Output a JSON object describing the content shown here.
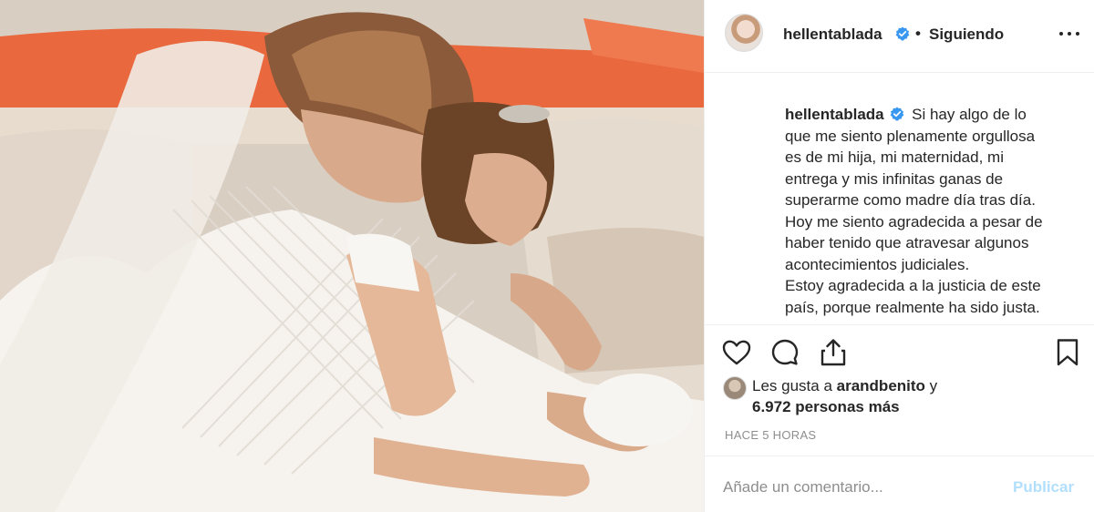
{
  "post": {
    "photo_description_icon": "wedding-photo",
    "header": {
      "username": "hellentablada",
      "verified_icon": "verified-badge-icon",
      "separator": "•",
      "follow_status": "Siguiendo",
      "more_icon": "more-options-icon"
    },
    "caption": {
      "username": "hellentablada",
      "lines": [
        "Si hay algo de lo",
        "que me siento plenamente orgullosa",
        "es de mi hija, mi maternidad, mi",
        "entrega y mis infinitas ganas de",
        "superarme como madre día tras día.",
        "Hoy me siento agradecida a pesar de",
        "haber tenido que atravesar algunos",
        "acontecimientos judiciales.",
        "Estoy agradecida a la justicia de este",
        "país, porque realmente ha sido justa."
      ]
    },
    "actions": {
      "like_icon": "heart-icon",
      "comment_icon": "comment-icon",
      "share_icon": "share-icon",
      "save_icon": "bookmark-icon"
    },
    "likes": {
      "prefix": "Les gusta a",
      "first_user": "arandbenito",
      "conjunction": "y",
      "others": "6.972 personas más"
    },
    "timestamp": "HACE 5 HORAS",
    "comment": {
      "placeholder": "Añade un comentario...",
      "submit_label": "Publicar"
    },
    "colors": {
      "verified": "#3897f0",
      "publish_disabled": "#b2dffc",
      "muted_text": "#8e8e8e"
    }
  }
}
